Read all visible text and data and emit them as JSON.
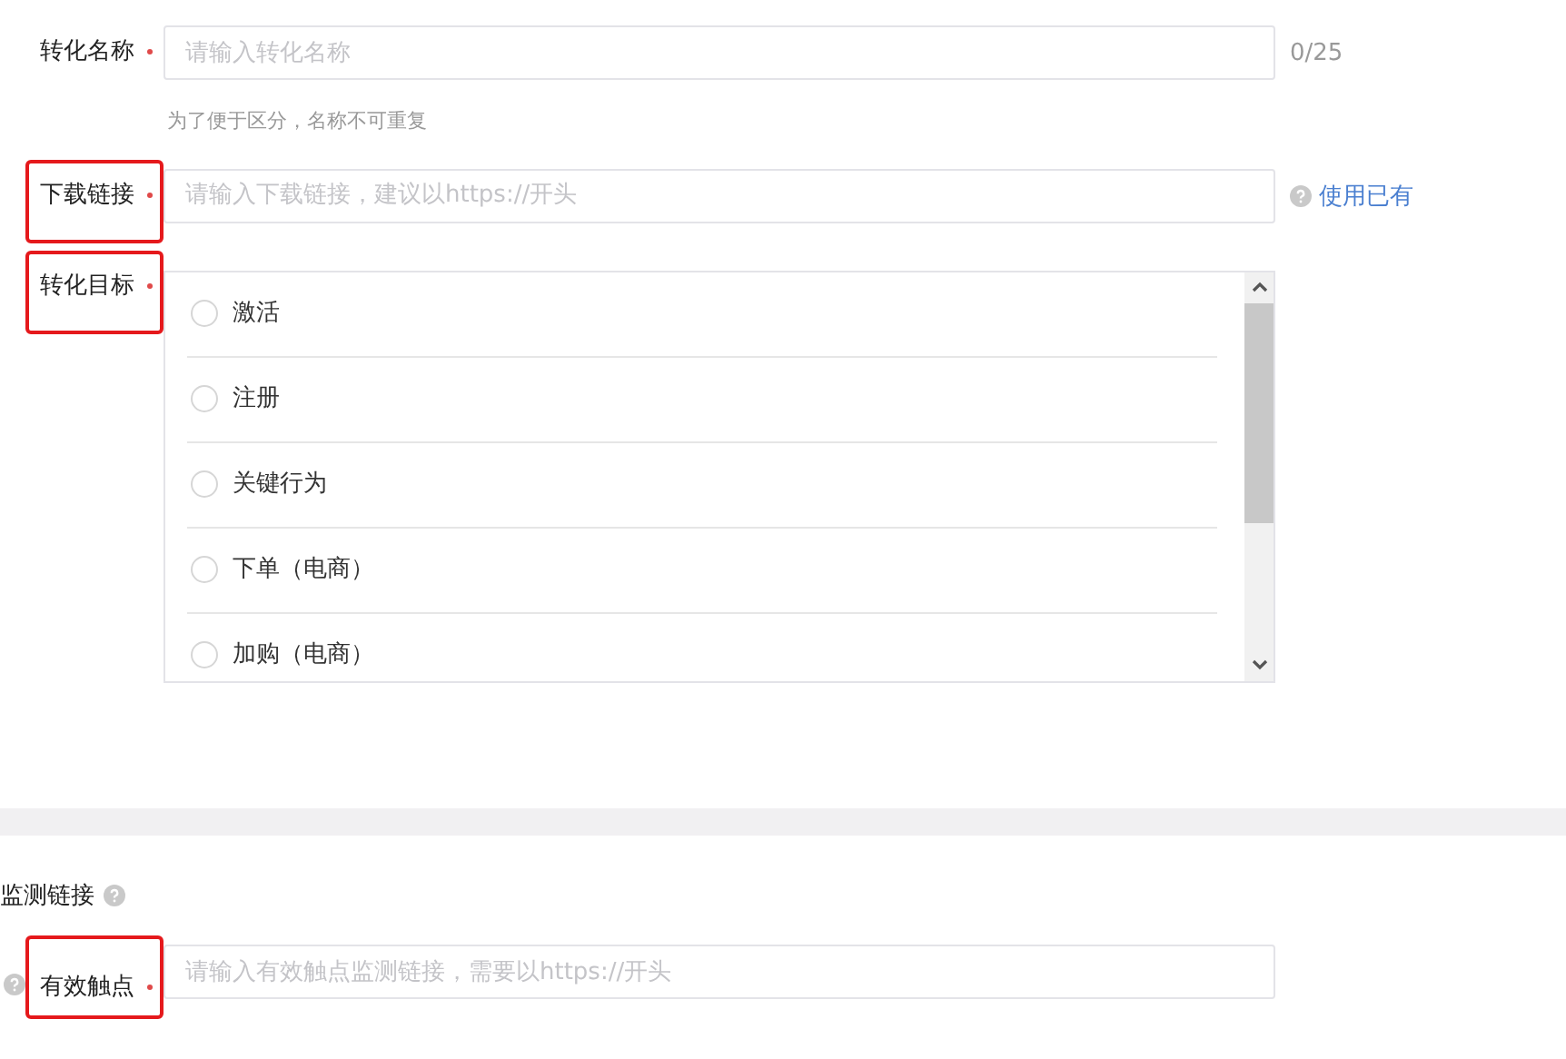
{
  "fields": [
    {
      "kind": "text",
      "label": "转化名称",
      "required": true,
      "highlighted": false,
      "placeholder": "请输入转化名称",
      "hint": "为了便于区分，名称不可重复",
      "counter": "0/25"
    },
    {
      "kind": "text",
      "label": "下载链接",
      "required": true,
      "highlighted": true,
      "placeholder": "请输入下载链接，建议以https://开头",
      "link": "使用已有"
    },
    {
      "kind": "radio-list",
      "label": "转化目标",
      "required": true,
      "highlighted": true,
      "options": [
        {
          "label": "激活",
          "selected": false
        },
        {
          "label": "注册",
          "selected": false
        },
        {
          "label": "关键行为",
          "selected": false
        },
        {
          "label": "下单（电商）",
          "selected": false
        },
        {
          "label": "加购（电商）",
          "selected": false
        }
      ]
    }
  ],
  "monitor": {
    "title": "监测链接",
    "fields": [
      {
        "kind": "text",
        "label": "有效触点",
        "required": true,
        "highlighted": true,
        "placeholder": "请输入有效触点监测链接，需要以https://开头"
      }
    ]
  }
}
